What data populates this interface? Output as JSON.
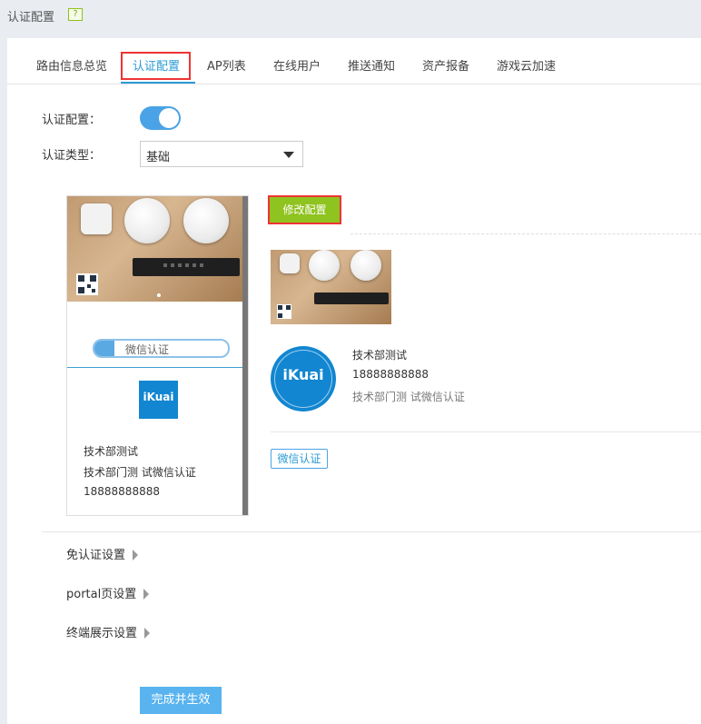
{
  "page": {
    "title": "认证配置",
    "help_glyph": "?"
  },
  "tabs": [
    {
      "label": "路由信息总览"
    },
    {
      "label": "认证配置",
      "active": true
    },
    {
      "label": "AP列表"
    },
    {
      "label": "在线用户"
    },
    {
      "label": "推送通知"
    },
    {
      "label": "资产报备"
    },
    {
      "label": "游戏云加速"
    }
  ],
  "form": {
    "auth_config_label": "认证配置：",
    "auth_enabled": true,
    "auth_type_label": "认证类型：",
    "auth_type_value": "基础"
  },
  "preview": {
    "wechat_button": "微信认证",
    "logo_text": "iKuai",
    "company": "技术部测试",
    "description": "技术部门测 试微信认证",
    "phone": "18888888888"
  },
  "config": {
    "modify_button": "修改配置",
    "logo_text": "iKuai",
    "company": "技术部测试",
    "phone": "18888888888",
    "description": "技术部门测 试微信认证",
    "auth_tag": "微信认证"
  },
  "sections": [
    {
      "label": "免认证设置"
    },
    {
      "label": "portal页设置"
    },
    {
      "label": "终端展示设置"
    }
  ],
  "submit_button": "完成并生效",
  "colors": {
    "accent": "#2a9bd5",
    "toggle_on": "#4aa3e6",
    "modify_green": "#8fc31f",
    "submit_blue": "#58b3ef",
    "highlight_red": "#e33333"
  }
}
